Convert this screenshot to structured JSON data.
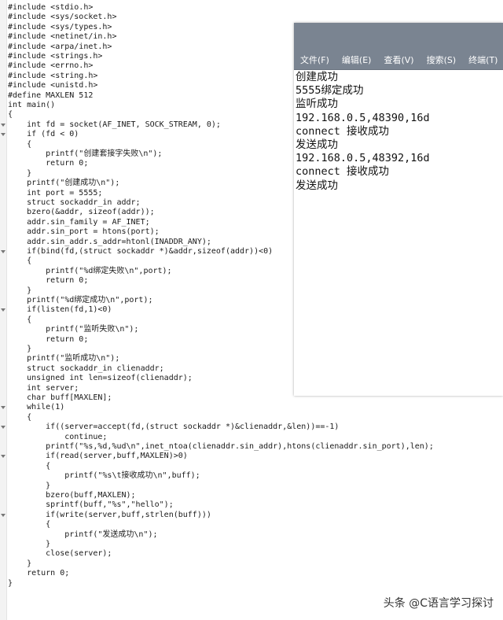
{
  "editor": {
    "lines": [
      "#include <stdio.h>",
      "#include <sys/socket.h>",
      "#include <sys/types.h>",
      "#include <netinet/in.h>",
      "#include <arpa/inet.h>",
      "#include <strings.h>",
      "#include <errno.h>",
      "#include <string.h>",
      "#include <unistd.h>",
      "#define MAXLEN 512",
      "int main()",
      "{",
      "    int fd = socket(AF_INET, SOCK_STREAM, 0);",
      "    if (fd < 0)",
      "    {",
      "        printf(\"创建套接字失败\\n\");",
      "        return 0;",
      "    }",
      "    printf(\"创建成功\\n\");",
      "    int port = 5555;",
      "    struct sockaddr_in addr;",
      "    bzero(&addr, sizeof(addr));",
      "    addr.sin_family = AF_INET;",
      "    addr.sin_port = htons(port);",
      "    addr.sin_addr.s_addr=htonl(INADDR_ANY);",
      "    if(bind(fd,(struct sockaddr *)&addr,sizeof(addr))<0)",
      "    {",
      "        printf(\"%d绑定失败\\n\",port);",
      "        return 0;",
      "    }",
      "    printf(\"%d绑定成功\\n\",port);",
      "    if(listen(fd,1)<0)",
      "    {",
      "        printf(\"监听失败\\n\");",
      "        return 0;",
      "    }",
      "    printf(\"监听成功\\n\");",
      "    struct sockaddr_in clienaddr;",
      "    unsigned int len=sizeof(clienaddr);",
      "    int server;",
      "    char buff[MAXLEN];",
      "    while(1)",
      "    {",
      "        if((server=accept(fd,(struct sockaddr *)&clienaddr,&len))==-1)",
      "            continue;",
      "        printf(\"%s,%d,%ud\\n\",inet_ntoa(clienaddr.sin_addr),htons(clienaddr.sin_port),len);",
      "        if(read(server,buff,MAXLEN)>0)",
      "        {",
      "            printf(\"%s\\t接收成功\\n\",buff);",
      "        }",
      "        bzero(buff,MAXLEN);",
      "        sprintf(buff,\"%s\",\"hello\");",
      "        if(write(server,buff,strlen(buff)))",
      "        {",
      "            printf(\"发送成功\\n\");",
      "        }",
      "        close(server);",
      "    }",
      "    return 0;",
      "}"
    ]
  },
  "terminal": {
    "menu": [
      "文件(F)",
      "编辑(E)",
      "查看(V)",
      "搜索(S)",
      "终端(T)"
    ],
    "output": [
      "创建成功",
      "5555绑定成功",
      "监听成功",
      "192.168.0.5,48390,16d",
      "connect 接收成功",
      "发送成功",
      "192.168.0.5,48392,16d",
      "connect 接收成功",
      "发送成功"
    ]
  },
  "watermark": "头条 @C语言学习探讨"
}
